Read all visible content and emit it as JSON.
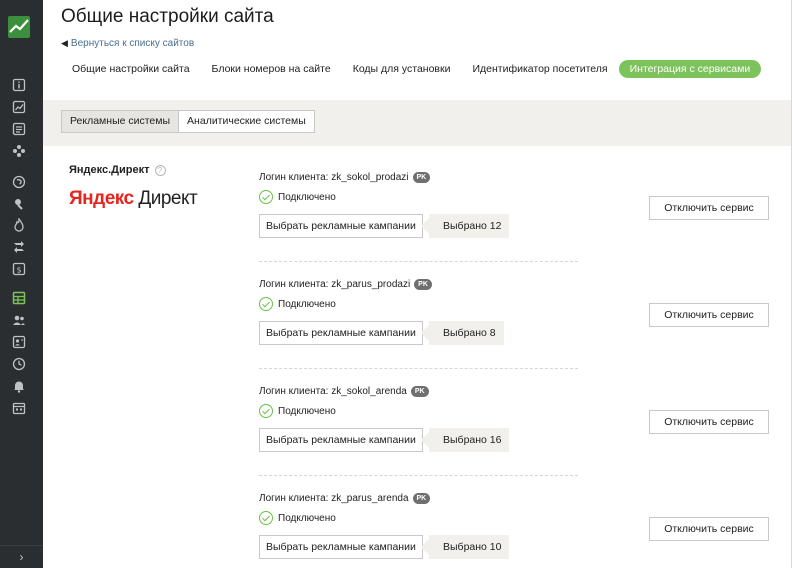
{
  "page": {
    "title": "Общие настройки сайта",
    "back_link": "Вернуться к списку сайтов"
  },
  "tabs": [
    {
      "label": "Общие настройки сайта",
      "active": false
    },
    {
      "label": "Блоки номеров на сайте",
      "active": false
    },
    {
      "label": "Коды для установки",
      "active": false
    },
    {
      "label": "Идентификатор посетителя",
      "active": false
    },
    {
      "label": "Интеграция с сервисами",
      "active": true
    }
  ],
  "subtabs": [
    {
      "label": "Рекламные системы",
      "active": true
    },
    {
      "label": "Аналитические системы",
      "active": false
    }
  ],
  "service": {
    "name": "Яндекс.Директ",
    "help_icon": "?",
    "brand_logo_text_red": "Яндекс",
    "brand_logo_text_dark": "Директ"
  },
  "accounts": [
    {
      "login_label": "Логин клиента: zk_sokol_prodazi",
      "badge": "PK",
      "status": "Подключено",
      "choose_label": "Выбрать рекламные кампании",
      "selected": "Выбрано 12",
      "disable_label": "Отключить сервис"
    },
    {
      "login_label": "Логин клиента: zk_parus_prodazi",
      "badge": "PK",
      "status": "Подключено",
      "choose_label": "Выбрать рекламные кампании",
      "selected": "Выбрано 8",
      "disable_label": "Отключить сервис"
    },
    {
      "login_label": "Логин клиента: zk_sokol_arenda",
      "badge": "PK",
      "status": "Подключено",
      "choose_label": "Выбрать рекламные кампании",
      "selected": "Выбрано 16",
      "disable_label": "Отключить сервис"
    },
    {
      "login_label": "Логин клиента: zk_parus_arenda",
      "badge": "PK",
      "status": "Подключено",
      "choose_label": "Выбрать рекламные кампании",
      "selected": "Выбрано 10",
      "disable_label": "Отключить сервис"
    }
  ],
  "sidebar": {
    "icons": [
      "info-icon",
      "chart-icon",
      "list-icon",
      "network-icon",
      "phone-icon",
      "pin-icon",
      "fire-icon",
      "call-forward-icon",
      "money-icon",
      "table-icon",
      "users-icon",
      "contacts-icon",
      "clock-icon",
      "bell-icon",
      "calendar-icon"
    ],
    "expand_glyph": "›"
  },
  "colors": {
    "sidebar_bg": "#2b2e30",
    "accent_green": "#7dc35b",
    "band_bg": "#f2f0ec",
    "brand_red": "#e52620",
    "link_blue": "#4a6f8f"
  }
}
